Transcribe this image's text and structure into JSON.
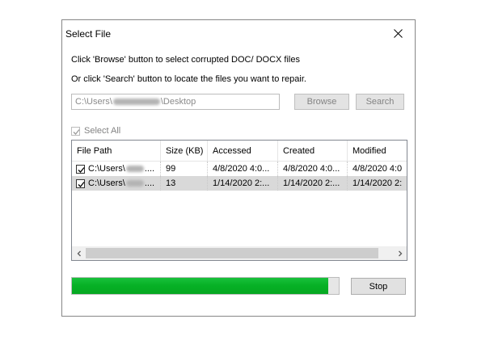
{
  "dialog": {
    "title": "Select File",
    "close_icon": "close-icon"
  },
  "instructions": {
    "line1": "Click 'Browse' button to select corrupted DOC/ DOCX files",
    "line2": "Or click 'Search' button to locate the files you want to repair."
  },
  "path": {
    "prefix": "C:\\Users\\",
    "suffix": "\\Desktop"
  },
  "buttons": {
    "browse": "Browse",
    "search": "Search",
    "stop": "Stop"
  },
  "select_all": {
    "label": "Select All",
    "checked": true,
    "enabled": false
  },
  "table": {
    "columns": [
      "File Path",
      "Size (KB)",
      "Accessed",
      "Created",
      "Modified"
    ],
    "rows": [
      {
        "checked": true,
        "selected": false,
        "path_prefix": "C:\\Users\\",
        "path_suffix": "....",
        "size": "99",
        "accessed": "4/8/2020 4:0...",
        "created": "4/8/2020 4:0...",
        "modified": "4/8/2020 4:0"
      },
      {
        "checked": true,
        "selected": true,
        "path_prefix": "C:\\Users\\",
        "path_suffix": "....",
        "size": "13",
        "accessed": "1/14/2020 2:...",
        "created": "1/14/2020 2:...",
        "modified": "1/14/2020 2:"
      }
    ]
  },
  "progress": {
    "fraction": 0.96,
    "color": "#06b025"
  },
  "icons": {
    "scroll_left": "chevron-left-icon",
    "scroll_right": "chevron-right-icon",
    "checkmark": "checkmark-icon"
  }
}
